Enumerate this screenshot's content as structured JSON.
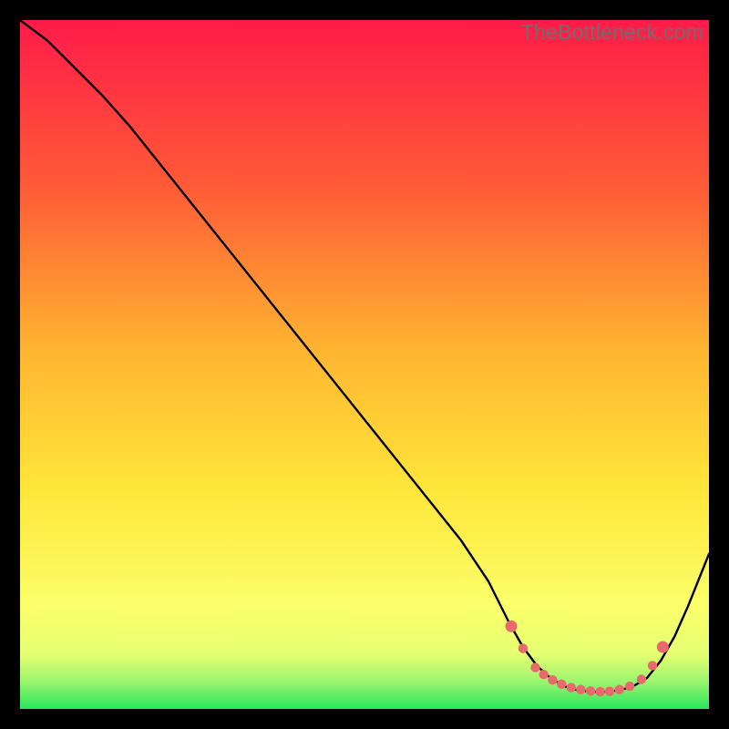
{
  "watermark": "TheBottleneck.com",
  "colors": {
    "bg_black": "#000000",
    "grad_top": "#ff1b49",
    "grad_mid1": "#ff7a2a",
    "grad_mid2": "#ffe63a",
    "grad_low1": "#faff6a",
    "grad_low2": "#d8ff72",
    "grad_bottom": "#28e65c",
    "line": "#000000",
    "marker_fill": "#e86a6c",
    "marker_stroke": "#c94f52"
  },
  "chart_data": {
    "type": "line",
    "title": "",
    "xlabel": "",
    "ylabel": "",
    "xlim": [
      0,
      100
    ],
    "ylim": [
      0,
      100
    ],
    "series": [
      {
        "name": "curve",
        "x": [
          0,
          4,
          8,
          12,
          16,
          20,
          24,
          28,
          32,
          36,
          40,
          44,
          48,
          52,
          56,
          60,
          64,
          68,
          71,
          73,
          75,
          77,
          79,
          81,
          83,
          85,
          87,
          89,
          91,
          93,
          95,
          97,
          100
        ],
        "y": [
          100,
          97,
          93,
          89,
          84.5,
          79.5,
          74.5,
          69.5,
          64.5,
          59.5,
          54.5,
          49.5,
          44.5,
          39.5,
          34.5,
          29.5,
          24.5,
          18.5,
          12.5,
          9.0,
          6.3,
          4.5,
          3.3,
          2.7,
          2.5,
          2.5,
          2.7,
          3.3,
          4.5,
          7.0,
          10.5,
          15.0,
          22.5
        ]
      }
    ],
    "markers": {
      "name": "bottleneck-band",
      "x": [
        71.3,
        73.0,
        74.8,
        76.0,
        77.3,
        78.6,
        80.0,
        81.4,
        82.8,
        84.2,
        85.6,
        87.0,
        88.5,
        90.2,
        91.8,
        93.3
      ],
      "y": [
        12.0,
        8.8,
        6.0,
        5.0,
        4.2,
        3.6,
        3.1,
        2.8,
        2.6,
        2.5,
        2.55,
        2.8,
        3.3,
        4.3,
        6.3,
        9.0
      ]
    }
  }
}
